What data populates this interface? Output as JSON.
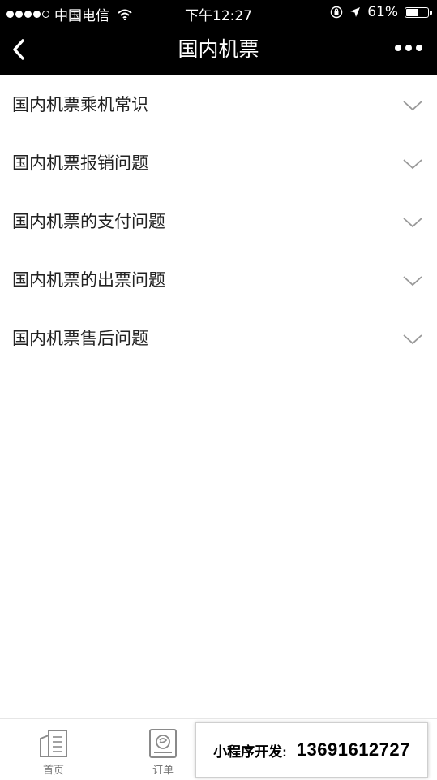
{
  "status_bar": {
    "carrier": "中国电信",
    "time": "下午12:27",
    "battery": "61%",
    "battery_level": 0.61,
    "signal_bars": 4,
    "signal_total": 5
  },
  "nav": {
    "title": "国内机票",
    "back_icon": "chevron-left-icon",
    "more_icon": "more-dots-icon"
  },
  "faq": {
    "items": [
      {
        "label": "国内机票乘机常识"
      },
      {
        "label": "国内机票报销问题"
      },
      {
        "label": "国内机票的支付问题"
      },
      {
        "label": "国内机票的出票问题"
      },
      {
        "label": "国内机票售后问题"
      }
    ]
  },
  "tabbar": {
    "tabs": [
      {
        "label": "首页",
        "icon": "home-document-icon"
      },
      {
        "label": "订单",
        "icon": "order-icon"
      }
    ]
  },
  "promo": {
    "label": "小程序开发:",
    "number": "13691612727"
  }
}
